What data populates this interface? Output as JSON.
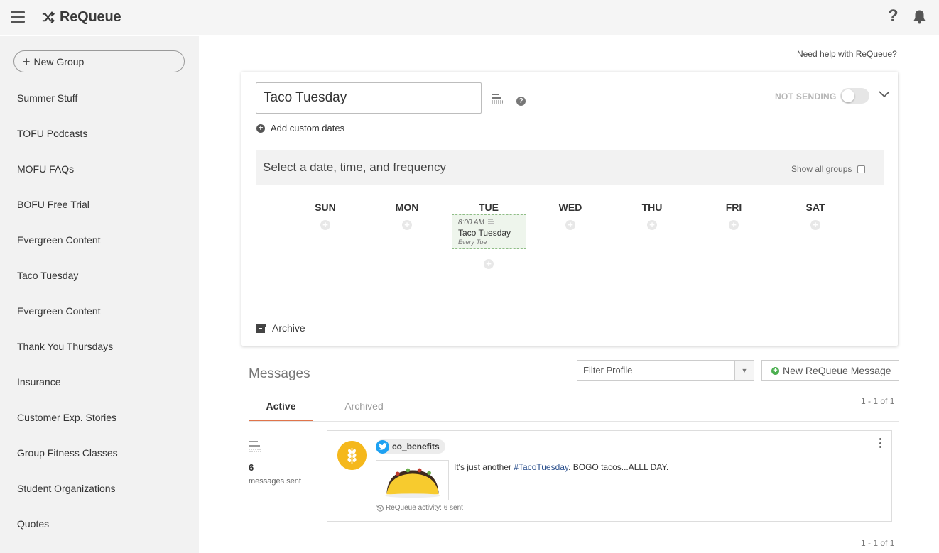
{
  "app": {
    "title": "ReQueue",
    "help_glyph": "?",
    "icons": [
      "hamburger-icon",
      "shuffle-icon",
      "help-icon",
      "bell-icon"
    ]
  },
  "sidebar": {
    "new_group_label": "New Group",
    "groups": [
      "Summer Stuff",
      "TOFU Podcasts",
      "MOFU FAQs",
      "BOFU Free Trial",
      "Evergreen Content",
      "Taco Tuesday",
      "Evergreen Content",
      "Thank You Thursdays",
      "Insurance",
      "Customer Exp. Stories",
      "Group Fitness Classes",
      "Student Organizations",
      "Quotes"
    ]
  },
  "main": {
    "help_link": "Need help with ReQueue?",
    "group": {
      "name": "Taco Tuesday",
      "status": "NOT SENDING",
      "sending": false,
      "add_custom_dates": "Add custom dates",
      "schedule_title": "Select a date, time, and frequency",
      "show_all_groups": "Show all groups",
      "show_all_checked": false,
      "days": [
        "SUN",
        "MON",
        "TUE",
        "WED",
        "THU",
        "FRI",
        "SAT"
      ],
      "slot": {
        "day": "TUE",
        "time": "8:00 AM",
        "name": "Taco Tuesday",
        "frequency": "Every Tue"
      },
      "archive_label": "Archive"
    },
    "messages": {
      "title": "Messages",
      "filter_placeholder": "Filter Profile",
      "new_message_label": "New ReQueue Message",
      "tabs": {
        "active": "Active",
        "archived": "Archived"
      },
      "pagination": "1 - 1 of 1",
      "items": [
        {
          "sent_count": "6",
          "sent_label": "messages sent",
          "profile": "co_benefits",
          "network": "twitter",
          "text_before": "It's just another ",
          "hashtag": "#TacoTuesday",
          "text_after": ". BOGO tacos...ALLL DAY.",
          "activity": "ReQueue activity: 6 sent"
        }
      ]
    }
  },
  "colors": {
    "accent_tab": "#e0744a",
    "twitter": "#1da1f2",
    "avatar": "#f5b81c",
    "slot_bg": "#eef5ec",
    "add_button": "#4caf50"
  }
}
